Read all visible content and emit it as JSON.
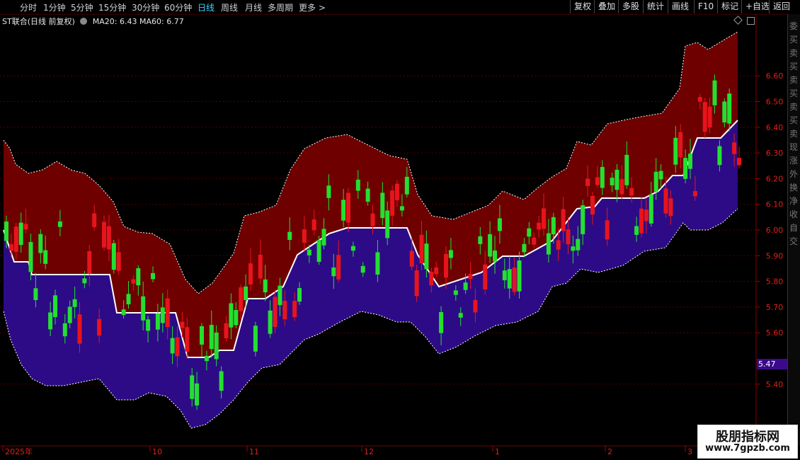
{
  "toolbar": {
    "timeframes": [
      "分时",
      "1分钟",
      "5分钟",
      "15分钟",
      "30分钟",
      "60分钟",
      "日线",
      "周线",
      "月线",
      "多周期",
      "更多 >"
    ],
    "active": "日线",
    "right_buttons": [
      "复权",
      "叠加",
      "多股",
      "统计",
      "画线",
      "F10",
      "标记",
      "+自选",
      "返回"
    ]
  },
  "legend": {
    "stock": "ST联合(日线 前复权)",
    "ma20": "MA20: 6.43",
    "ma60": "MA60: 6.77"
  },
  "current_price": "5.47",
  "watermark": {
    "line1": "股朋指标网",
    "line2": "www.7gpzb.com"
  },
  "side_chars": [
    "委",
    "买",
    "卖",
    "买",
    "卖",
    "买",
    "卖",
    "买",
    "卖",
    "现",
    "涨",
    "外",
    "换",
    "净",
    "收",
    "自",
    "交"
  ],
  "colors": {
    "up": "#e8141c",
    "down": "#22e030",
    "upper_band": "#6e0000",
    "lower_band": "#2d0b86",
    "midline": "#ffffff",
    "grid": "#550000"
  },
  "chart_data": {
    "type": "candlestick",
    "y_ticks": [
      "6.60",
      "6.50",
      "6.40",
      "6.30",
      "6.20",
      "6.10",
      "6.00",
      "5.90",
      "5.80",
      "5.70",
      "5.60",
      "5.40"
    ],
    "x_labels": [
      "2025年",
      "10",
      "11",
      "12",
      "1",
      "2",
      "3"
    ]
  }
}
